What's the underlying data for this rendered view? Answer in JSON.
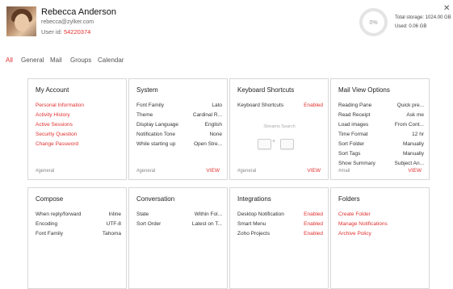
{
  "user": {
    "name": "Rebecca Anderson",
    "email": "rebecca@zylker.com",
    "id_label": "User id:",
    "id_value": "54220374"
  },
  "storage": {
    "percent_label": "0%",
    "used_fraction": 0,
    "total": "Total storage: 1024.00 GB",
    "used": "Used: 0.06 GB"
  },
  "tabs": [
    "All",
    "General",
    "Mail",
    "Groups",
    "Calendar"
  ],
  "active_tab": "All",
  "cards": {
    "my_account": {
      "title": "My Account",
      "links": [
        "Personal Information",
        "Activity History",
        "Active Sessions",
        "Security Question",
        "Change Password"
      ],
      "tag": "#general"
    },
    "system": {
      "title": "System",
      "rows": [
        {
          "k": "Font Family",
          "v": "Lato"
        },
        {
          "k": "Theme",
          "v": "Cardinal R..."
        },
        {
          "k": "Display Language",
          "v": "English"
        },
        {
          "k": "Notification Tone",
          "v": "None"
        },
        {
          "k": "While starting up",
          "v": "Open Stre..."
        }
      ],
      "tag": "#general",
      "view": "VIEW"
    },
    "keyboard": {
      "title": "Keyboard Shortcuts",
      "rows": [
        {
          "k": "Keyboard Shortcuts",
          "v": "Enabled"
        }
      ],
      "preview_label": "Streams Search",
      "tag": "#general",
      "view": "VIEW"
    },
    "mail_view": {
      "title": "Mail View Options",
      "rows": [
        {
          "k": "Reading Pane",
          "v": "Quick pre..."
        },
        {
          "k": "Read Receipt",
          "v": "Ask me"
        },
        {
          "k": "Load images",
          "v": "From Cont..."
        },
        {
          "k": "Time Format",
          "v": "12 hr"
        },
        {
          "k": "Sort Folder",
          "v": "Manually"
        },
        {
          "k": "Sort Tags",
          "v": "Manually"
        },
        {
          "k": "Show Summary",
          "v": "Subject An..."
        }
      ],
      "tag": "#mail",
      "view": "VIEW"
    },
    "compose": {
      "title": "Compose",
      "rows": [
        {
          "k": "When reply/forward",
          "v": "Inline"
        },
        {
          "k": "Encoding",
          "v": "UTF-8"
        },
        {
          "k": "Font Family",
          "v": "Tahoma"
        }
      ]
    },
    "conversation": {
      "title": "Conversation",
      "rows": [
        {
          "k": "State",
          "v": "Within Fol..."
        },
        {
          "k": "Sort Order",
          "v": "Latest on T..."
        }
      ]
    },
    "integrations": {
      "title": "Integrations",
      "rows": [
        {
          "k": "Desktop Notification",
          "v": "Enabled"
        },
        {
          "k": "Smart Menu",
          "v": "Enabled"
        },
        {
          "k": "Zoho Projects",
          "v": "Enabled"
        }
      ]
    },
    "folders": {
      "title": "Folders",
      "links": [
        "Create Folder",
        "Manage Notifications",
        "Archive Policy"
      ]
    }
  },
  "colors": {
    "accent": "#e0312f",
    "ring": "#e4e4e4"
  }
}
